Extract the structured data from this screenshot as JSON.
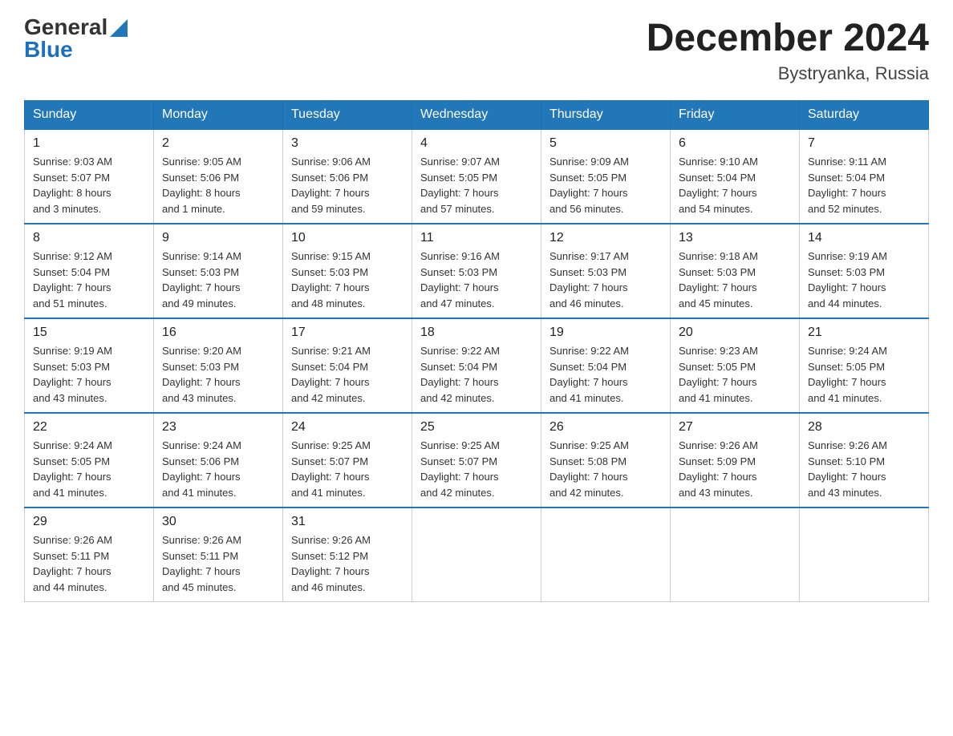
{
  "header": {
    "logo_general": "General",
    "logo_blue": "Blue",
    "month_title": "December 2024",
    "location": "Bystryanka, Russia"
  },
  "weekdays": [
    "Sunday",
    "Monday",
    "Tuesday",
    "Wednesday",
    "Thursday",
    "Friday",
    "Saturday"
  ],
  "weeks": [
    [
      {
        "day": "1",
        "info": "Sunrise: 9:03 AM\nSunset: 5:07 PM\nDaylight: 8 hours\nand 3 minutes."
      },
      {
        "day": "2",
        "info": "Sunrise: 9:05 AM\nSunset: 5:06 PM\nDaylight: 8 hours\nand 1 minute."
      },
      {
        "day": "3",
        "info": "Sunrise: 9:06 AM\nSunset: 5:06 PM\nDaylight: 7 hours\nand 59 minutes."
      },
      {
        "day": "4",
        "info": "Sunrise: 9:07 AM\nSunset: 5:05 PM\nDaylight: 7 hours\nand 57 minutes."
      },
      {
        "day": "5",
        "info": "Sunrise: 9:09 AM\nSunset: 5:05 PM\nDaylight: 7 hours\nand 56 minutes."
      },
      {
        "day": "6",
        "info": "Sunrise: 9:10 AM\nSunset: 5:04 PM\nDaylight: 7 hours\nand 54 minutes."
      },
      {
        "day": "7",
        "info": "Sunrise: 9:11 AM\nSunset: 5:04 PM\nDaylight: 7 hours\nand 52 minutes."
      }
    ],
    [
      {
        "day": "8",
        "info": "Sunrise: 9:12 AM\nSunset: 5:04 PM\nDaylight: 7 hours\nand 51 minutes."
      },
      {
        "day": "9",
        "info": "Sunrise: 9:14 AM\nSunset: 5:03 PM\nDaylight: 7 hours\nand 49 minutes."
      },
      {
        "day": "10",
        "info": "Sunrise: 9:15 AM\nSunset: 5:03 PM\nDaylight: 7 hours\nand 48 minutes."
      },
      {
        "day": "11",
        "info": "Sunrise: 9:16 AM\nSunset: 5:03 PM\nDaylight: 7 hours\nand 47 minutes."
      },
      {
        "day": "12",
        "info": "Sunrise: 9:17 AM\nSunset: 5:03 PM\nDaylight: 7 hours\nand 46 minutes."
      },
      {
        "day": "13",
        "info": "Sunrise: 9:18 AM\nSunset: 5:03 PM\nDaylight: 7 hours\nand 45 minutes."
      },
      {
        "day": "14",
        "info": "Sunrise: 9:19 AM\nSunset: 5:03 PM\nDaylight: 7 hours\nand 44 minutes."
      }
    ],
    [
      {
        "day": "15",
        "info": "Sunrise: 9:19 AM\nSunset: 5:03 PM\nDaylight: 7 hours\nand 43 minutes."
      },
      {
        "day": "16",
        "info": "Sunrise: 9:20 AM\nSunset: 5:03 PM\nDaylight: 7 hours\nand 43 minutes."
      },
      {
        "day": "17",
        "info": "Sunrise: 9:21 AM\nSunset: 5:04 PM\nDaylight: 7 hours\nand 42 minutes."
      },
      {
        "day": "18",
        "info": "Sunrise: 9:22 AM\nSunset: 5:04 PM\nDaylight: 7 hours\nand 42 minutes."
      },
      {
        "day": "19",
        "info": "Sunrise: 9:22 AM\nSunset: 5:04 PM\nDaylight: 7 hours\nand 41 minutes."
      },
      {
        "day": "20",
        "info": "Sunrise: 9:23 AM\nSunset: 5:05 PM\nDaylight: 7 hours\nand 41 minutes."
      },
      {
        "day": "21",
        "info": "Sunrise: 9:24 AM\nSunset: 5:05 PM\nDaylight: 7 hours\nand 41 minutes."
      }
    ],
    [
      {
        "day": "22",
        "info": "Sunrise: 9:24 AM\nSunset: 5:05 PM\nDaylight: 7 hours\nand 41 minutes."
      },
      {
        "day": "23",
        "info": "Sunrise: 9:24 AM\nSunset: 5:06 PM\nDaylight: 7 hours\nand 41 minutes."
      },
      {
        "day": "24",
        "info": "Sunrise: 9:25 AM\nSunset: 5:07 PM\nDaylight: 7 hours\nand 41 minutes."
      },
      {
        "day": "25",
        "info": "Sunrise: 9:25 AM\nSunset: 5:07 PM\nDaylight: 7 hours\nand 42 minutes."
      },
      {
        "day": "26",
        "info": "Sunrise: 9:25 AM\nSunset: 5:08 PM\nDaylight: 7 hours\nand 42 minutes."
      },
      {
        "day": "27",
        "info": "Sunrise: 9:26 AM\nSunset: 5:09 PM\nDaylight: 7 hours\nand 43 minutes."
      },
      {
        "day": "28",
        "info": "Sunrise: 9:26 AM\nSunset: 5:10 PM\nDaylight: 7 hours\nand 43 minutes."
      }
    ],
    [
      {
        "day": "29",
        "info": "Sunrise: 9:26 AM\nSunset: 5:11 PM\nDaylight: 7 hours\nand 44 minutes."
      },
      {
        "day": "30",
        "info": "Sunrise: 9:26 AM\nSunset: 5:11 PM\nDaylight: 7 hours\nand 45 minutes."
      },
      {
        "day": "31",
        "info": "Sunrise: 9:26 AM\nSunset: 5:12 PM\nDaylight: 7 hours\nand 46 minutes."
      },
      {
        "day": "",
        "info": ""
      },
      {
        "day": "",
        "info": ""
      },
      {
        "day": "",
        "info": ""
      },
      {
        "day": "",
        "info": ""
      }
    ]
  ]
}
